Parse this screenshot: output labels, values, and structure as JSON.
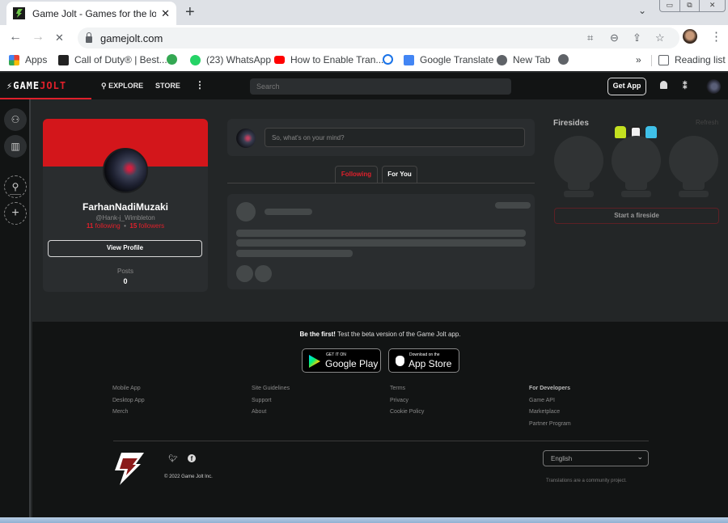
{
  "browser": {
    "tab_title": "Game Jolt - Games for the love of",
    "tab_close": "✕",
    "new_tab": "+",
    "tab_menu": "⌄",
    "window_controls": [
      "▭",
      "⧉",
      "✕"
    ],
    "url": "gamejolt.com",
    "back": "←",
    "forward": "→",
    "stop": "✕",
    "toolbar_icons": [
      "translate-icon",
      "zoom-out-icon",
      "share-icon",
      "bookmark-star-icon"
    ],
    "bookmarks": [
      {
        "label": "Apps",
        "icon": "apps-grid-icon",
        "color": "#ea4335"
      },
      {
        "label": "Call of Duty® | Best...",
        "icon": "cod-icon",
        "color": "#222222"
      },
      {
        "label": "",
        "icon": "bolt-circle-icon",
        "color": "#34a853"
      },
      {
        "label": "(23) WhatsApp",
        "icon": "whatsapp-icon",
        "color": "#25d366"
      },
      {
        "label": "How to Enable Tran...",
        "icon": "youtube-icon",
        "color": "#ff0000"
      },
      {
        "label": "",
        "icon": "history-icon",
        "color": "#1a73e8"
      },
      {
        "label": "Google Translate",
        "icon": "google-translate-icon",
        "color": "#4285f4"
      },
      {
        "label": "New Tab",
        "icon": "globe-icon",
        "color": "#5f6368"
      },
      {
        "label": "",
        "icon": "globe-icon",
        "color": "#5f6368"
      }
    ],
    "more_bookmarks": "»",
    "reading_list": "Reading list"
  },
  "header": {
    "logo_left": "GAME",
    "logo_right": "JOLT",
    "explore": "EXPLORE",
    "store": "STORE",
    "more": "⋮",
    "search_placeholder": "Search",
    "get_app": "Get App",
    "accent": "#e0202b"
  },
  "profile": {
    "name": "FarhanNadiMuzaki",
    "handle": "@Hank-j_Wimbleton",
    "following_count": "11",
    "following_label": "following",
    "separator": "•",
    "followers_count": "15",
    "followers_label": "followers",
    "view_profile": "View Profile",
    "posts_label": "Posts",
    "posts_value": "0",
    "banner_color": "#d3161b"
  },
  "feed": {
    "composer_placeholder": "So, what's on your mind?",
    "tabs": [
      {
        "label": "Following",
        "active": true
      },
      {
        "label": "For You",
        "active": false
      }
    ]
  },
  "firesides": {
    "title": "Firesides",
    "refresh": "Refresh",
    "start": "Start a fireside"
  },
  "footer": {
    "beta_bold": "Be the first!",
    "beta_text": " Test the beta version of the Game Jolt app.",
    "google_play_small": "GET IT ON",
    "google_play_big": "Google Play",
    "app_store_small": "Download on the",
    "app_store_big": "App Store",
    "columns": [
      {
        "header": "",
        "links": [
          "Mobile App",
          "Desktop App",
          "Merch"
        ]
      },
      {
        "header": "",
        "links": [
          "Site Guidelines",
          "Support",
          "About"
        ]
      },
      {
        "header": "",
        "links": [
          "Terms",
          "Privacy",
          "Cookie Policy"
        ]
      },
      {
        "header": "For Developers",
        "links": [
          "Game API",
          "Marketplace",
          "Partner Program"
        ]
      }
    ],
    "copyright": "© 2022 Game Jolt Inc.",
    "language": "English",
    "translations_note": "Translations are a community project."
  }
}
